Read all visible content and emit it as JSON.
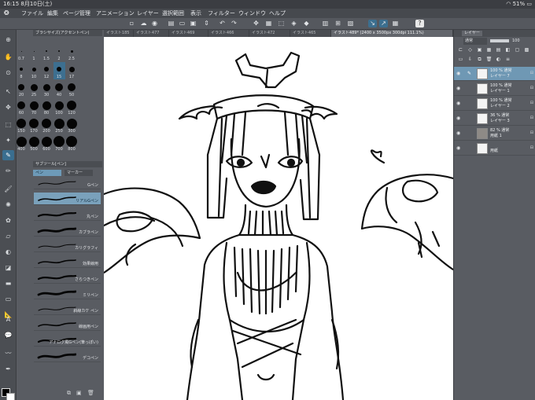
{
  "status": {
    "time": "16:15",
    "date": "8月10日(土)",
    "battery": "51%"
  },
  "menu": {
    "items": [
      "ファイル",
      "編集",
      "ページ管理",
      "アニメーション",
      "レイヤー",
      "選択範囲",
      "表示",
      "フィルター",
      "ウィンドウ",
      "ヘルプ"
    ]
  },
  "tabs": [
    {
      "label": "イラスト185"
    },
    {
      "label": "イラスト477"
    },
    {
      "label": "イラスト469"
    },
    {
      "label": "イラスト466"
    },
    {
      "label": "イラスト472"
    },
    {
      "label": "イラスト465"
    },
    {
      "label": "イラスト489* (2400 x 3500px 300dpi 111.1%)"
    }
  ],
  "brush_panel": {
    "title": "ブラシサイズ(アクセントペン)",
    "size_labels_row1": [
      "0.7",
      "1",
      "1.5",
      "2",
      "2.5"
    ],
    "size_labels_row2": [
      "8",
      "10",
      "12",
      "15",
      "17"
    ],
    "size_labels_row3": [
      "20",
      "25",
      "30",
      "40",
      "50"
    ],
    "size_labels_row4": [
      "60",
      "70",
      "80",
      "100",
      "120"
    ],
    "size_labels_row5": [
      "150",
      "170",
      "200",
      "250",
      "300"
    ],
    "size_labels_row6": [
      "400",
      "500",
      "600",
      "700",
      "800"
    ]
  },
  "subtool": {
    "title": "サブツール[ペン]",
    "tabs": [
      "ペン",
      "マーカー"
    ],
    "brushes": [
      "Gペン",
      "リアルGペン",
      "丸ペン",
      "カブラペン",
      "カリグラフィ",
      "効果線用",
      "さらつきペン",
      "ミリペン",
      "斜線カケ ペン",
      "線画用ペン",
      "アナログ風Gペン(筆っぽい)",
      "デコペン"
    ]
  },
  "layer_panel": {
    "tab": "レイヤー",
    "blend_mode": "通常",
    "opacity": "100",
    "layers": [
      {
        "line1": "100 % 通常",
        "line2": "レイヤー 7"
      },
      {
        "line1": "100 % 通常",
        "line2": "レイヤー 1"
      },
      {
        "line1": "100 % 通常",
        "line2": "レイヤー 2"
      },
      {
        "line1": "36 % 通常",
        "line2": "レイヤー 3"
      },
      {
        "line1": "82 % 通常",
        "line2": "用紙 1"
      },
      {
        "line1": "",
        "line2": "用紙"
      }
    ]
  }
}
